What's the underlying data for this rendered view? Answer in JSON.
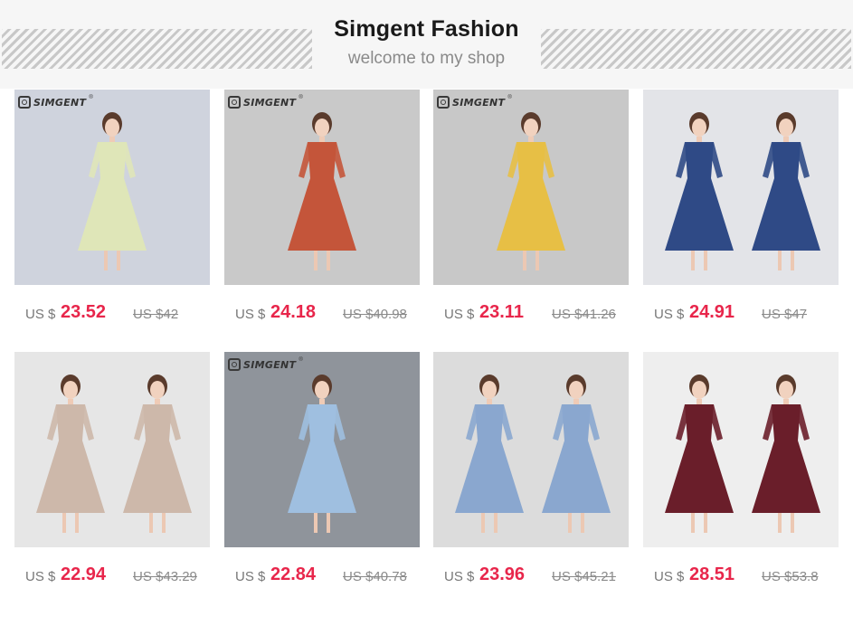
{
  "header": {
    "title": "Simgent Fashion",
    "subtitle": "welcome to my shop"
  },
  "logo_text": "SIMGENT",
  "logo_reg": "®",
  "colors": {
    "price": "#e8264b",
    "header_bg": "#f6f6f6"
  },
  "products": [
    {
      "currency": "US $",
      "price": "23.52",
      "old_price": "US $42",
      "dress_color": "#dfe6b8",
      "bg": "#cfd3dd",
      "logo": true
    },
    {
      "currency": "US $",
      "price": "24.18",
      "old_price": "US $40.98",
      "dress_color": "#c4553a",
      "bg": "#c9c9c9",
      "logo": true
    },
    {
      "currency": "US $",
      "price": "23.11",
      "old_price": "US $41.26",
      "dress_color": "#e7bf45",
      "bg": "#c8c8c8",
      "logo": true
    },
    {
      "currency": "US $",
      "price": "24.91",
      "old_price": "US $47",
      "dress_color": "#2f4a86",
      "bg": "#e3e4e8",
      "logo": false
    },
    {
      "currency": "US $",
      "price": "22.94",
      "old_price": "US $43.29",
      "dress_color": "#cdb8aa",
      "bg": "#e6e6e6",
      "logo": false
    },
    {
      "currency": "US $",
      "price": "22.84",
      "old_price": "US $40.78",
      "dress_color": "#9fbfe0",
      "bg": "#8f949b",
      "logo": true
    },
    {
      "currency": "US $",
      "price": "23.96",
      "old_price": "US $45.21",
      "dress_color": "#8aa7cf",
      "bg": "#dcdcdc",
      "logo": false
    },
    {
      "currency": "US $",
      "price": "28.51",
      "old_price": "US $53.8",
      "dress_color": "#6a1e2a",
      "bg": "#eeeeee",
      "logo": false
    }
  ]
}
